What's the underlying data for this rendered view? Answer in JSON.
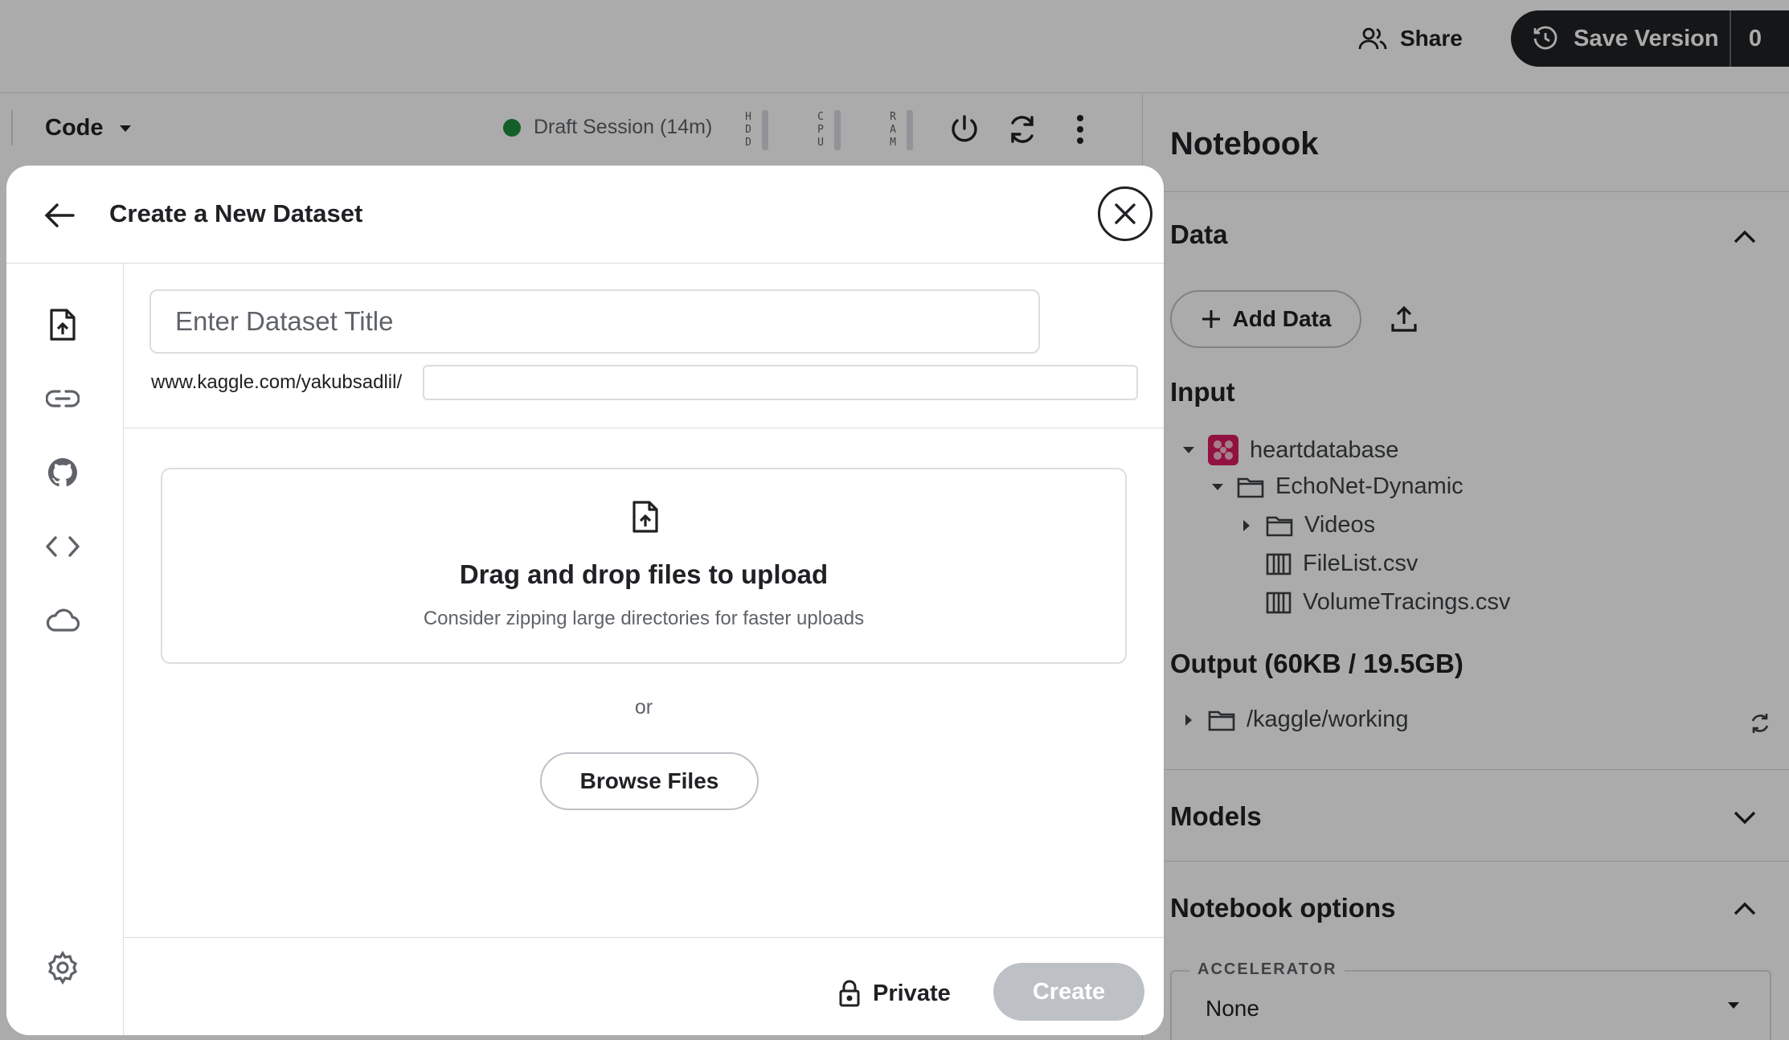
{
  "topbar": {
    "share_label": "Share",
    "save_label": "Save Version",
    "save_count": "0"
  },
  "editor": {
    "mode_label": "Code",
    "session_label": "Draft Session (14m)",
    "session_status_color": "#1e8e3e",
    "meters": [
      "H D D",
      "C P U",
      "R A M"
    ]
  },
  "right_panel": {
    "title": "Notebook",
    "data_section": "Data",
    "add_data_label": "Add Data",
    "input_label": "Input",
    "tree": [
      {
        "label": "heartdatabase",
        "icon": "dataset-logo-icon"
      },
      {
        "label": "EchoNet-Dynamic",
        "icon": "folder-icon"
      },
      {
        "label": "Videos",
        "icon": "folder-icon"
      },
      {
        "label": "FileList.csv",
        "icon": "csv-table-icon"
      },
      {
        "label": "VolumeTracings.csv",
        "icon": "csv-table-icon"
      }
    ],
    "output_label": "Output (60KB / 19.5GB)",
    "output_path": "/kaggle/working",
    "models_section": "Models",
    "options_section": "Notebook options",
    "accelerator_legend": "ACCELERATOR",
    "accelerator_value": "None"
  },
  "modal": {
    "title": "Create a New Dataset",
    "title_placeholder": "Enter Dataset Title",
    "url_prefix": "www.kaggle.com/yakubsadlil/",
    "url_value": "",
    "drop_title": "Drag and drop files to upload",
    "drop_subtitle": "Consider zipping large directories for faster uploads",
    "or_text": "or",
    "browse_label": "Browse Files",
    "private_label": "Private",
    "create_label": "Create",
    "sidebar_icons": [
      "file-upload-icon",
      "link-icon",
      "github-icon",
      "code-icon",
      "cloud-icon",
      "settings-icon"
    ]
  }
}
